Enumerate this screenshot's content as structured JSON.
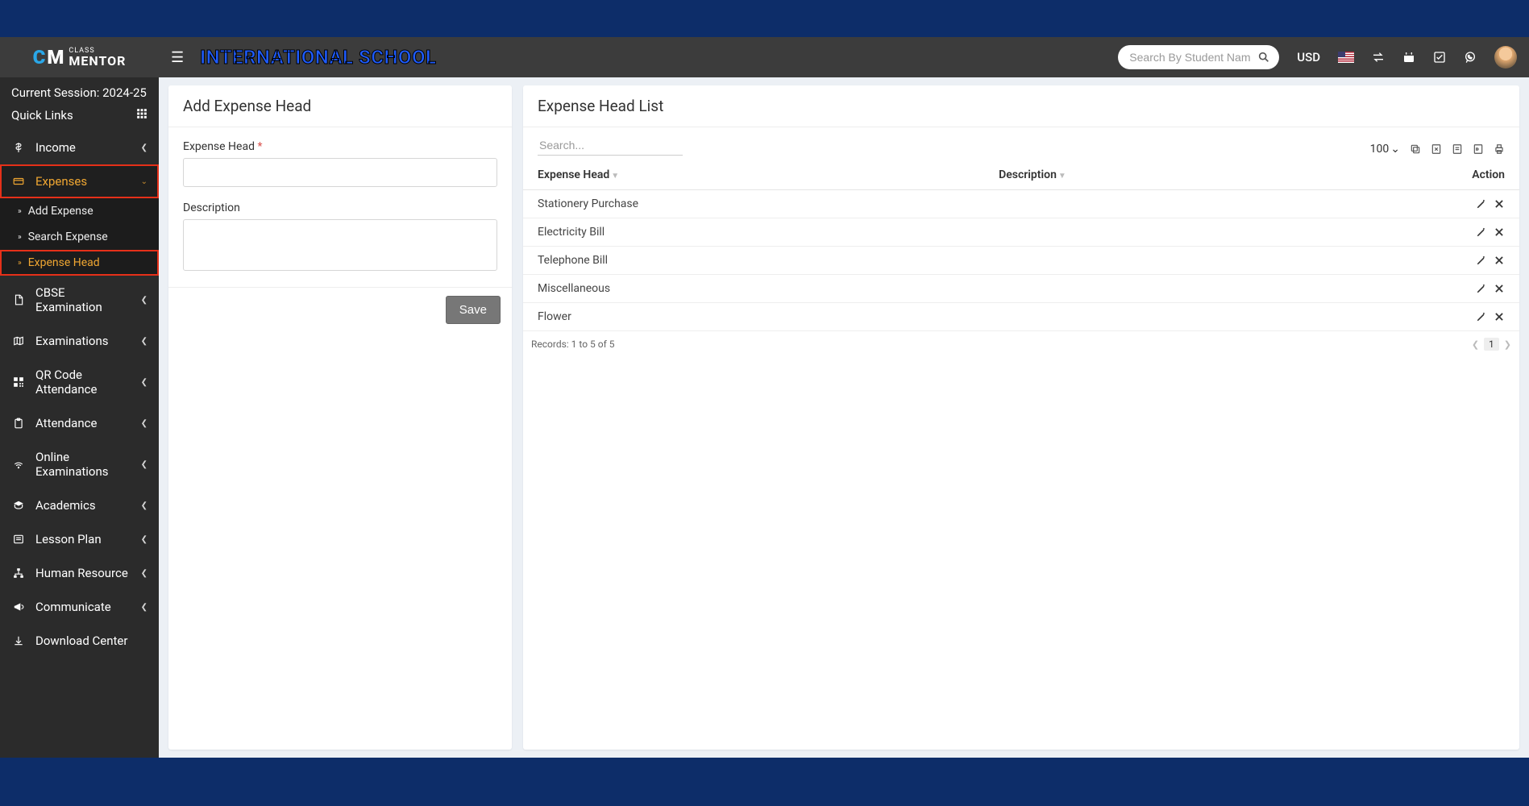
{
  "session_label": "Current Session: 2024-25",
  "quick_links_label": "Quick Links",
  "header": {
    "title": "INTERNATIONAL SCHOOL",
    "search_placeholder": "Search By Student Name",
    "currency": "USD"
  },
  "sidebar": {
    "income": "Income",
    "expenses": "Expenses",
    "add_expense": "Add Expense",
    "search_expense": "Search Expense",
    "expense_head": "Expense Head",
    "cbse": "CBSE Examination",
    "exams": "Examinations",
    "qr": "QR Code Attendance",
    "attendance": "Attendance",
    "online_exams": "Online Examinations",
    "academics": "Academics",
    "lesson": "Lesson Plan",
    "hr": "Human Resource",
    "communicate": "Communicate",
    "download": "Download Center"
  },
  "form": {
    "title": "Add Expense Head",
    "head_label": "Expense Head",
    "desc_label": "Description",
    "save": "Save"
  },
  "list": {
    "title": "Expense Head List",
    "search_placeholder": "Search...",
    "page_size": "100",
    "col_head": "Expense Head",
    "col_desc": "Description",
    "col_action": "Action",
    "rows": [
      {
        "head": "Stationery Purchase",
        "desc": ""
      },
      {
        "head": "Electricity Bill",
        "desc": ""
      },
      {
        "head": "Telephone Bill",
        "desc": ""
      },
      {
        "head": "Miscellaneous",
        "desc": ""
      },
      {
        "head": "Flower",
        "desc": ""
      }
    ],
    "records_label": "Records: 1 to 5 of 5",
    "current_page": "1"
  }
}
